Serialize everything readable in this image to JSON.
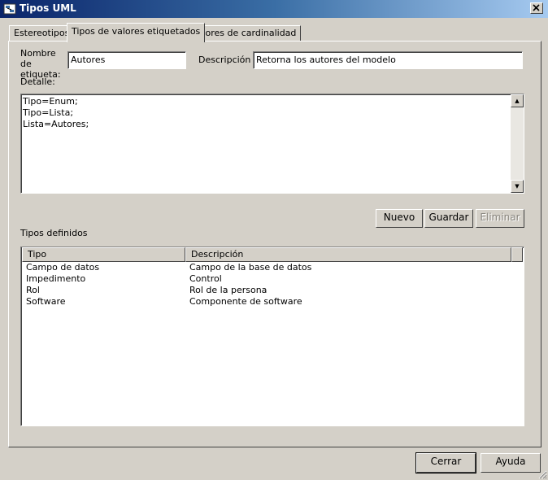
{
  "window": {
    "title": "Tipos UML"
  },
  "tabs": [
    {
      "label": "Estereotipos"
    },
    {
      "label": "Tipos de valores etiquetados"
    },
    {
      "label": "Valores de cardinalidad"
    }
  ],
  "form": {
    "tag_name_label": "Nombre de etiqueta:",
    "tag_name_value": "Autores",
    "description_label": "Descripción",
    "description_value": "Retorna los autores del modelo",
    "detail_label": "Detalle:",
    "detail_lines": [
      "Tipo=Enum;",
      "Tipo=Lista;",
      "Lista=Autores;"
    ]
  },
  "actions": {
    "new_label": "Nuevo",
    "save_label": "Guardar",
    "delete_label": "Eliminar"
  },
  "defined_types": {
    "section_label": "Tipos definidos",
    "columns": [
      "Tipo",
      "Descripción"
    ],
    "rows": [
      [
        "Campo de datos",
        "Campo de la base de datos"
      ],
      [
        "Impedimento",
        "Control"
      ],
      [
        "Rol",
        "Rol de la persona"
      ],
      [
        "Software",
        "Componente de software"
      ]
    ]
  },
  "footer": {
    "close_label": "Cerrar",
    "help_label": "Ayuda"
  }
}
